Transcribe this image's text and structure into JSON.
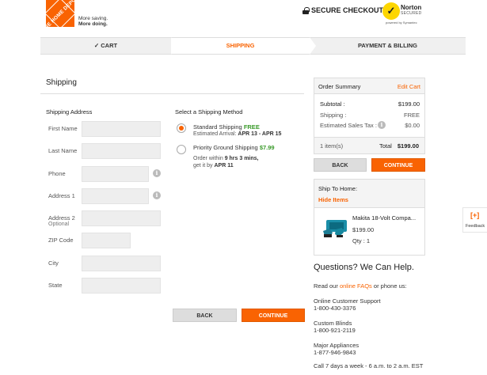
{
  "header": {
    "logo_text": "THE HOME DEPOT",
    "tagline_1": "More saving.",
    "tagline_2": "More doing.",
    "secure_checkout": "SECURE CHECKOUT",
    "norton_name": "Norton",
    "norton_secured": "SECURED",
    "norton_powered": "powered by Symantec",
    "brand_color": "#f96302"
  },
  "progress": {
    "cart": "CART",
    "shipping": "SHIPPING",
    "payment": "PAYMENT & BILLING"
  },
  "shipping": {
    "title": "Shipping",
    "address_title": "Shipping Address",
    "method_title": "Select a Shipping Method",
    "fields": {
      "first_name": "First Name",
      "last_name": "Last Name",
      "phone": "Phone",
      "address1": "Address 1",
      "address2": "Address 2",
      "address2_sub": "Optional",
      "zip": "ZIP Code",
      "city": "City",
      "state": "State"
    },
    "methods": {
      "standard_name": "Standard Shipping",
      "standard_price": "FREE",
      "standard_arrival_label": "Estimated Arrival:",
      "standard_arrival": "APR 13 - APR 15",
      "priority_name": "Priority Ground Shipping",
      "priority_price": "$7.99",
      "priority_line1_a": "Order within",
      "priority_line1_b": "9 hrs 3 mins,",
      "priority_line2_a": "get it by",
      "priority_line2_b": "APR 11"
    },
    "back": "BACK",
    "continue": "CONTINUE"
  },
  "summary": {
    "title": "Order Summary",
    "edit": "Edit Cart",
    "subtotal_label": "Subtotal :",
    "subtotal": "$199.00",
    "shipping_label": "Shipping :",
    "shipping": "FREE",
    "tax_label": "Estimated Sales Tax :",
    "tax": "$0.00",
    "items": "1 item(s)",
    "total_label": "Total",
    "total": "$199.00",
    "back": "BACK",
    "continue": "CONTINUE"
  },
  "ship_to_home": {
    "title": "Ship To Home:",
    "hide": "Hide Items",
    "product": "Makita 18-Volt Compa...",
    "price": "$199.00",
    "qty": "Qty : 1"
  },
  "help": {
    "title": "Questions? We Can Help.",
    "read_a": "Read our",
    "read_link": "online FAQs",
    "read_b": "or phone us:",
    "online_support": "Online Customer Support",
    "online_phone": "1-800-430-3376",
    "blinds": "Custom Blinds",
    "blinds_phone": "1-800-921-2119",
    "appliances": "Major Appliances",
    "appliances_phone": "1-877-946-9843",
    "hours": "Call 7 days a week - 6 a.m. to 2 a.m. EST"
  },
  "feedback": {
    "icon": "[+]",
    "label": "Feedback"
  }
}
